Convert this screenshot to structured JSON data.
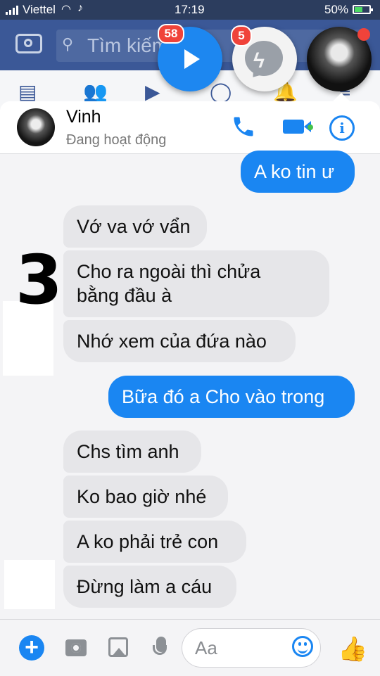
{
  "status_bar": {
    "carrier": "Viettel",
    "time": "17:19",
    "battery": "50%",
    "battery_level": 0.5
  },
  "fb_app": {
    "search_placeholder": "Tìm kiếm"
  },
  "chat_heads": {
    "video_badge": "58",
    "messenger_badge": "5"
  },
  "chat": {
    "contact_name": "Vinh",
    "contact_status": "Đang hoạt động",
    "messages": [
      {
        "side": "out",
        "text": "A ko tin ư"
      },
      {
        "side": "in",
        "text": "Vớ va vớ vẩn"
      },
      {
        "side": "in",
        "lines": [
          "Cho ra ngoài thì chửa",
          "bằng đầu à"
        ]
      },
      {
        "side": "in",
        "text": "Nhớ xem của đứa nào"
      },
      {
        "side": "out",
        "text": "Bữa đó a Cho vào trong"
      },
      {
        "side": "in",
        "text": "Chs tìm anh"
      },
      {
        "side": "in",
        "text": "Ko bao giờ nhé"
      },
      {
        "side": "in",
        "text": "A ko phải trẻ con"
      },
      {
        "side": "in",
        "text": "Đừng làm a cáu"
      }
    ]
  },
  "overlay": {
    "number": "3"
  },
  "composer": {
    "placeholder": "Aa"
  },
  "colors": {
    "messenger_blue": "#1a86f2",
    "fb_blue": "#3b5897",
    "online_green": "#44c24a",
    "badge_red": "#f0433a"
  }
}
